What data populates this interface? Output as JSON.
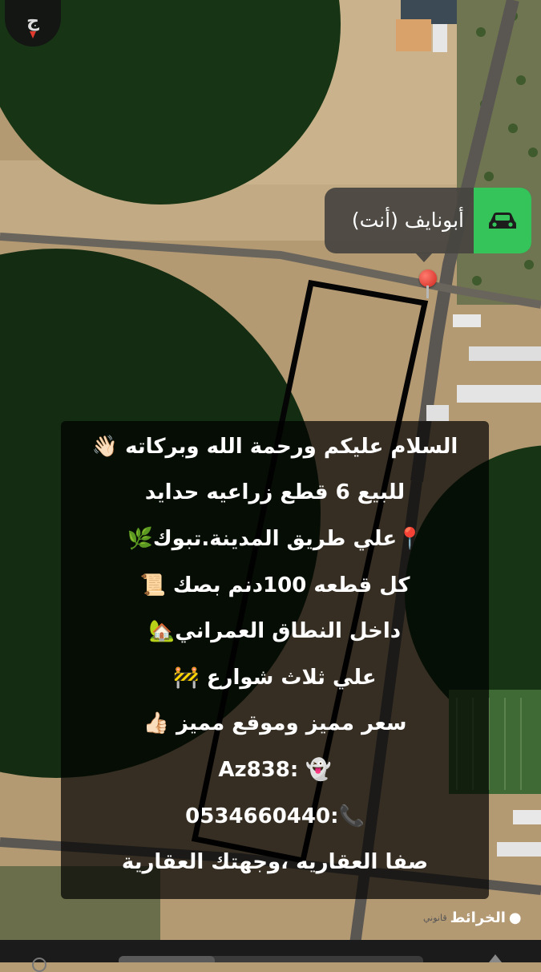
{
  "map": {
    "compass_label": "ج",
    "location_label": "أبونايف (أنت)",
    "location_icon": "car-icon",
    "pin_icon": "red-pin-icon",
    "attribution_brand": "الخرائط",
    "attribution_legal": "قانوني"
  },
  "post": {
    "lines": [
      "السلام عليكم ورحمة الله وبركاته 👋🏻",
      "للبيع 6 قطع زراعيه حدايد",
      "📍علي طريق المدينة.تبوك🌿",
      "كل قطعه 100دنم بصك 📜",
      "داخل النطاق العمراني🏡",
      "علي ثلاث شوارع 🚧",
      "سعر مميز وموقع مميز 👍🏻",
      "👻 :Az838",
      "📞:0534660440",
      "صفا العقاريه ،وجهتك العقارية"
    ]
  }
}
